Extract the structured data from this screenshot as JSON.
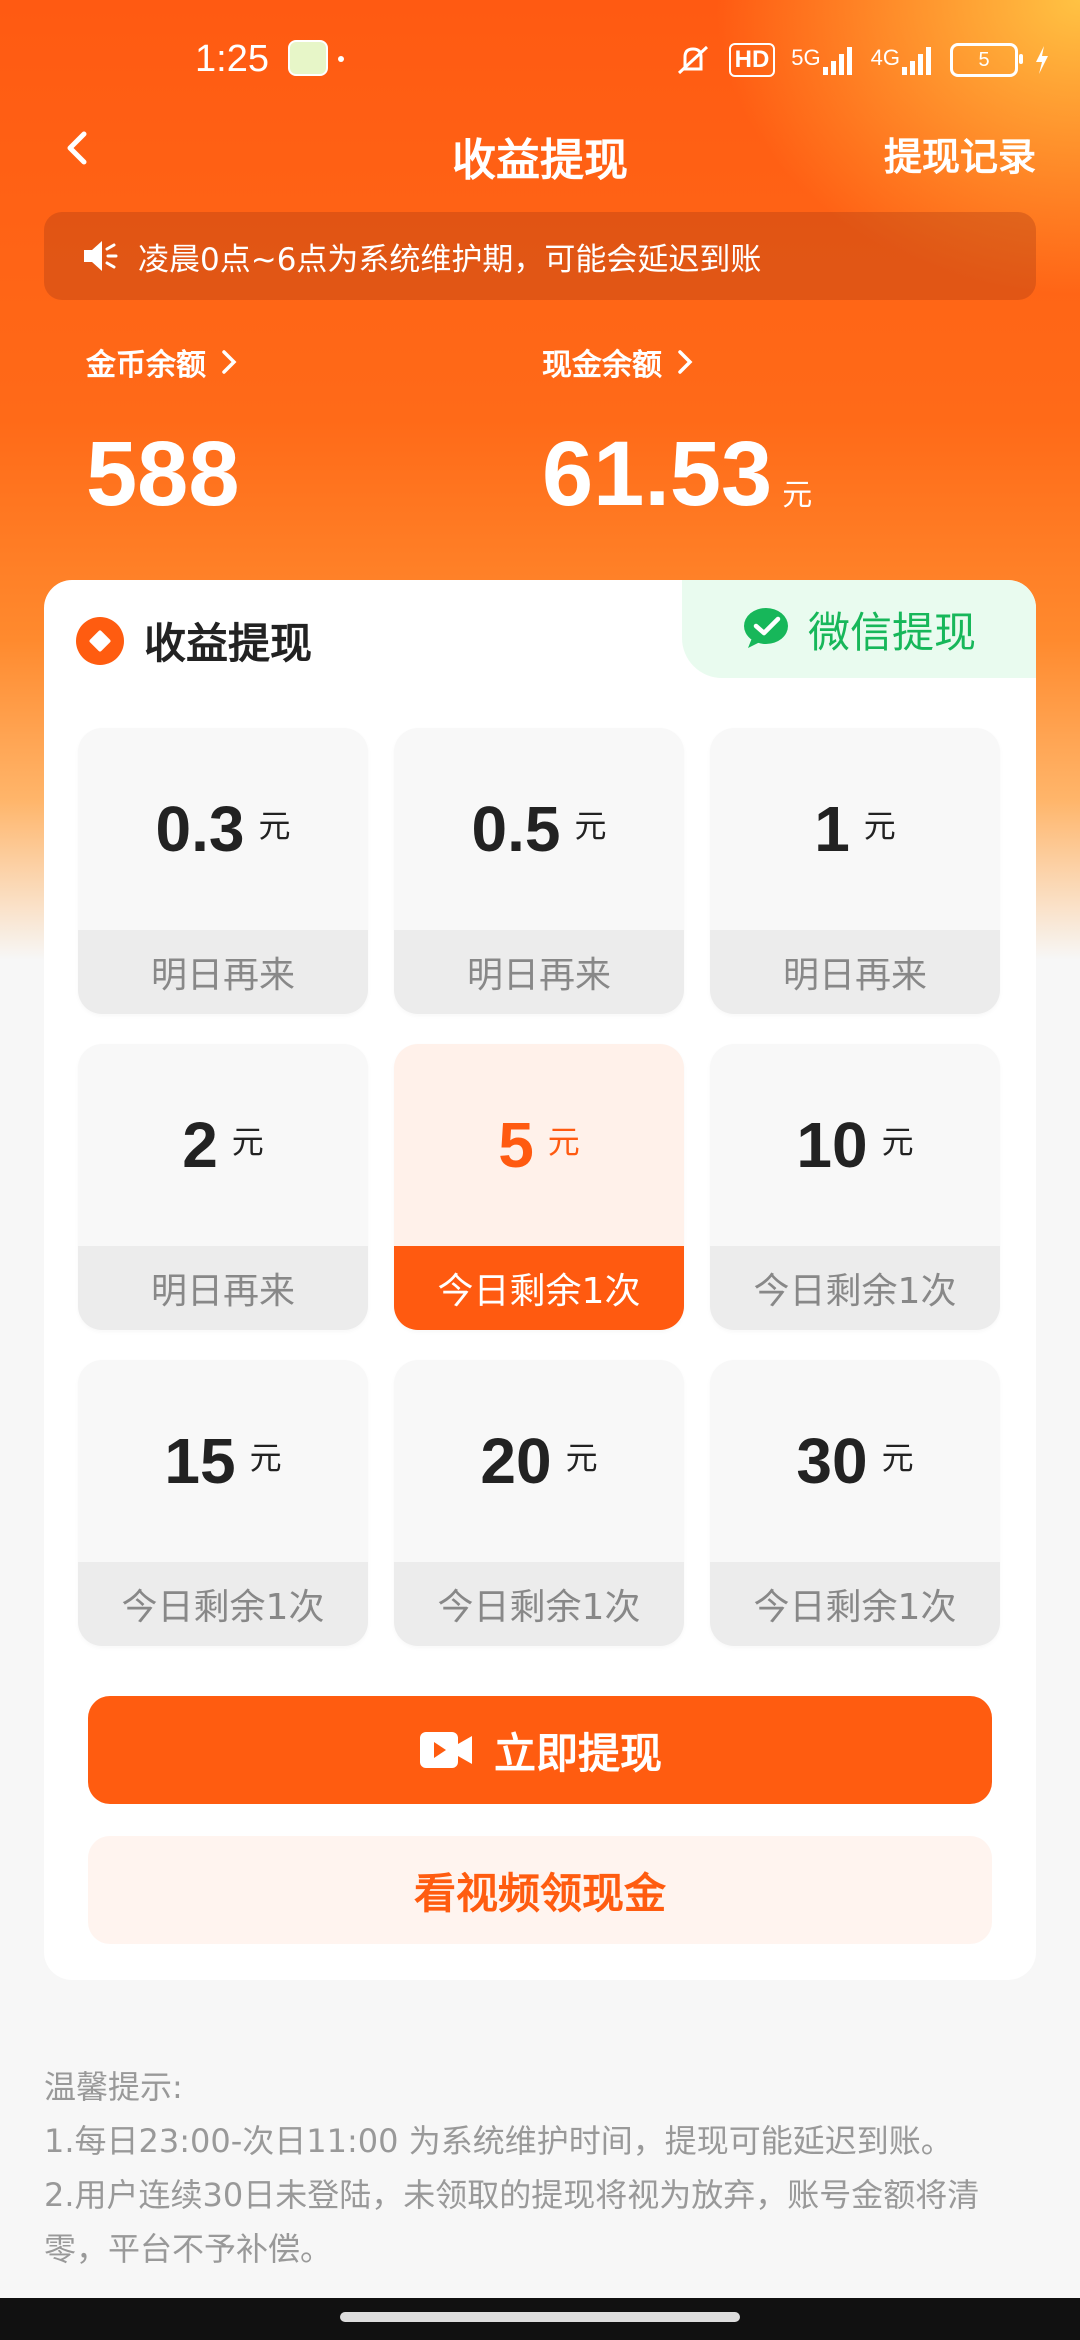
{
  "status": {
    "time": "1:25",
    "hd_label": "HD",
    "net1": "5G",
    "net2": "4G",
    "battery": "5"
  },
  "header": {
    "title": "收益提现",
    "records_label": "提现记录"
  },
  "notice": {
    "text": "凌晨0点~6点为系统维护期，可能会延迟到账"
  },
  "balances": {
    "coins_label": "金币余额",
    "coins_value": "588",
    "cash_label": "现金余额",
    "cash_value": "61.53",
    "cash_unit": "元"
  },
  "card": {
    "title": "收益提现",
    "wechat_label": "微信提现",
    "options": [
      {
        "amount": "0.3",
        "unit": "元",
        "status": "明日再来",
        "selected": false
      },
      {
        "amount": "0.5",
        "unit": "元",
        "status": "明日再来",
        "selected": false
      },
      {
        "amount": "1",
        "unit": "元",
        "status": "明日再来",
        "selected": false
      },
      {
        "amount": "2",
        "unit": "元",
        "status": "明日再来",
        "selected": false
      },
      {
        "amount": "5",
        "unit": "元",
        "status": "今日剩余1次",
        "selected": true
      },
      {
        "amount": "10",
        "unit": "元",
        "status": "今日剩余1次",
        "selected": false
      },
      {
        "amount": "15",
        "unit": "元",
        "status": "今日剩余1次",
        "selected": false
      },
      {
        "amount": "20",
        "unit": "元",
        "status": "今日剩余1次",
        "selected": false
      },
      {
        "amount": "30",
        "unit": "元",
        "status": "今日剩余1次",
        "selected": false
      }
    ],
    "withdraw_label": "立即提现",
    "video_label": "看视频领现金"
  },
  "tips": {
    "title": "温馨提示:",
    "line1": "1.每日23:00-次日11:00 为系统维护时间，提现可能延迟到账。",
    "line2": "2.用户连续30日未登陆，未领取的提现将视为放弃，账号金额将清零，平台不予补偿。"
  },
  "colors": {
    "accent": "#ff5c10",
    "wechat": "#17b75a"
  }
}
